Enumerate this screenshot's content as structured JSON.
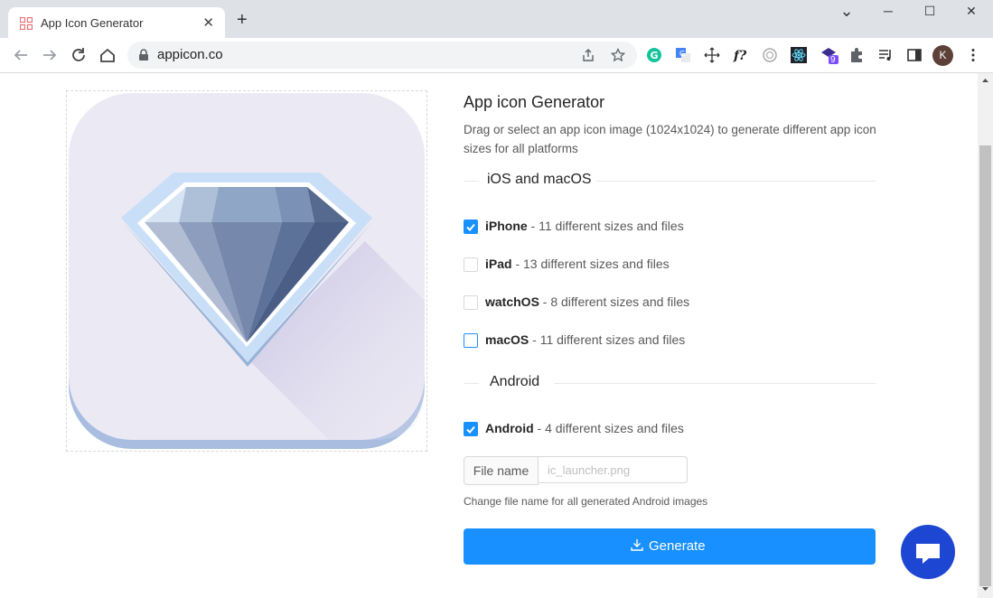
{
  "browser": {
    "tab_title": "App Icon Generator",
    "tab_close": "✕",
    "new_tab": "+",
    "url": "appicon.co",
    "ext_badge": "9",
    "profile_initial": "K",
    "minimize": "⌄",
    "maximize": "─",
    "restore": "☐",
    "close": "✕"
  },
  "main": {
    "title": "App icon Generator",
    "description": "Drag or select an app icon image (1024x1024) to generate different app icon sizes for all platforms",
    "ios_section": "iOS and macOS",
    "android_section": "Android",
    "options": [
      {
        "name": "iPhone",
        "detail": " - 11 different sizes and files",
        "checked": true
      },
      {
        "name": "iPad",
        "detail": " - 13 different sizes and files",
        "checked": false
      },
      {
        "name": "watchOS",
        "detail": " - 8 different sizes and files",
        "checked": false
      },
      {
        "name": "macOS",
        "detail": " - 11 different sizes and files",
        "checked": false
      },
      {
        "name": "Android",
        "detail": " - 4 different sizes and files",
        "checked": true
      }
    ],
    "file_name_label": "File name",
    "file_name_placeholder": "ic_launcher.png",
    "file_name_help": "Change file name for all generated Android images",
    "generate_label": "Generate"
  },
  "colors": {
    "primary": "#1890ff",
    "chat": "#1d47d3"
  }
}
